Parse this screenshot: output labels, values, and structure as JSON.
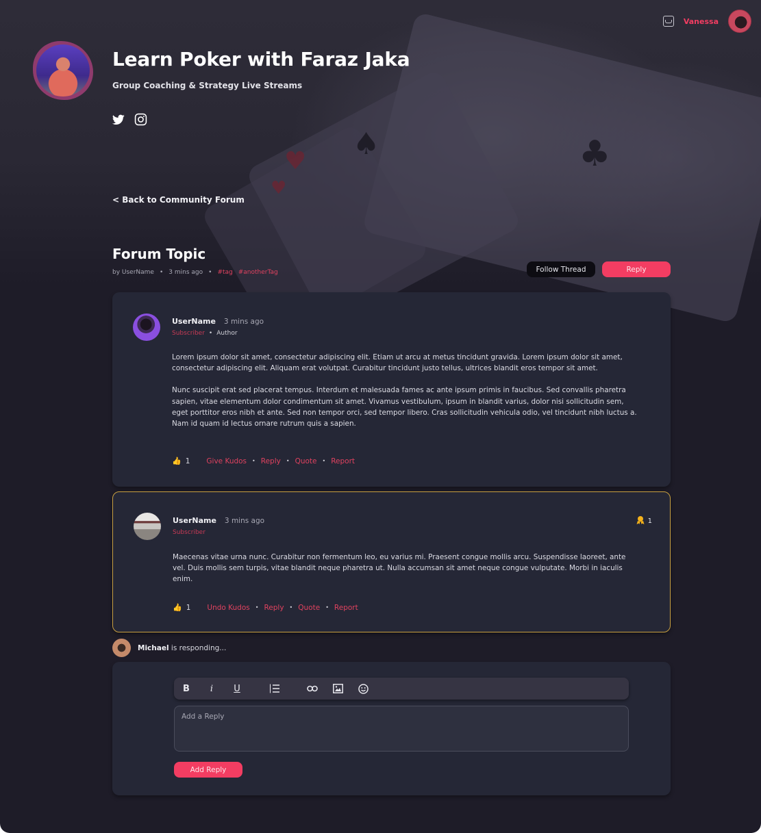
{
  "header": {
    "user_name": "Vanessa",
    "site_title": "Learn Poker with Faraz Jaka",
    "site_subtitle": "Group Coaching & Strategy Live Streams",
    "socials": [
      "twitter-icon",
      "instagram-icon"
    ],
    "back_link": "< Back to Community Forum"
  },
  "topic": {
    "title": "Forum Topic",
    "by": "by UserName",
    "time": "3 mins ago",
    "tags": [
      "#tag",
      "#anotherTag"
    ],
    "follow_label": "Follow Thread",
    "reply_label": "Reply"
  },
  "posts": [
    {
      "author": "UserName",
      "time": "3 mins ago",
      "role": "Subscriber",
      "extra_role": "Author",
      "paragraphs": [
        "Lorem ipsum dolor sit amet, consectetur adipiscing elit. Etiam ut arcu at metus tincidunt gravida. Lorem ipsum dolor sit amet, consectetur adipiscing elit. Aliquam erat volutpat. Curabitur tincidunt justo tellus, ultrices blandit eros tempor sit amet.",
        "Nunc suscipit erat sed placerat tempus. Interdum et malesuada fames ac ante ipsum primis in faucibus. Sed convallis pharetra sapien, vitae elementum dolor condimentum sit amet. Vivamus vestibulum, ipsum in blandit varius, dolor nisi sollicitudin sem, eget porttitor eros nibh et ante. Sed non tempor orci, sed tempor libero. Cras sollicitudin vehicula odio, vel tincidunt nibh luctus a. Nam id quam id lectus ornare rutrum quis a sapien."
      ],
      "kudos": "1",
      "kudos_action": "Give Kudos",
      "reply": "Reply",
      "quote": "Quote",
      "report": "Report"
    },
    {
      "author": "UserName",
      "time": "3 mins ago",
      "role": "Subscriber",
      "badge_count": "1",
      "paragraphs": [
        "Maecenas vitae urna nunc. Curabitur non fermentum leo, eu varius mi. Praesent congue mollis arcu. Suspendisse laoreet, ante vel. Duis mollis sem turpis, vitae blandit neque pharetra ut. Nulla accumsan sit amet neque congue vulputate. Morbi in iaculis enim."
      ],
      "kudos": "1",
      "kudos_action": "Undo Kudos",
      "reply": "Reply",
      "quote": "Quote",
      "report": "Report"
    }
  ],
  "responding": {
    "name": "Michael",
    "text": " is responding..."
  },
  "composer": {
    "toolbar": [
      "bold",
      "italic",
      "underline",
      "numbered-list",
      "link",
      "image",
      "emoji"
    ],
    "placeholder": "Add a Reply",
    "submit_label": "Add Reply"
  },
  "colors": {
    "accent": "#f33d62",
    "background": "#1e1c28",
    "card": "#252736",
    "highlight_border": "#c9a041",
    "kudos": "#f5b21b"
  }
}
